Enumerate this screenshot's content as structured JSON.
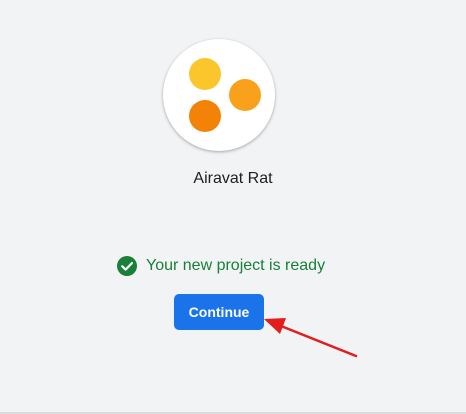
{
  "project": {
    "name": "Airavat Rat",
    "logo_icon": "project-logo-dots",
    "logo_colors": [
      "#FBC62B",
      "#F9A11B",
      "#F28307"
    ]
  },
  "status": {
    "icon": "check-circle-icon",
    "message": "Your new project is ready",
    "color": "#188038"
  },
  "actions": {
    "continue_label": "Continue",
    "accent": "#1A73E8"
  },
  "annotation": {
    "icon": "red-arrow-pointer",
    "color": "#E31C1C"
  }
}
